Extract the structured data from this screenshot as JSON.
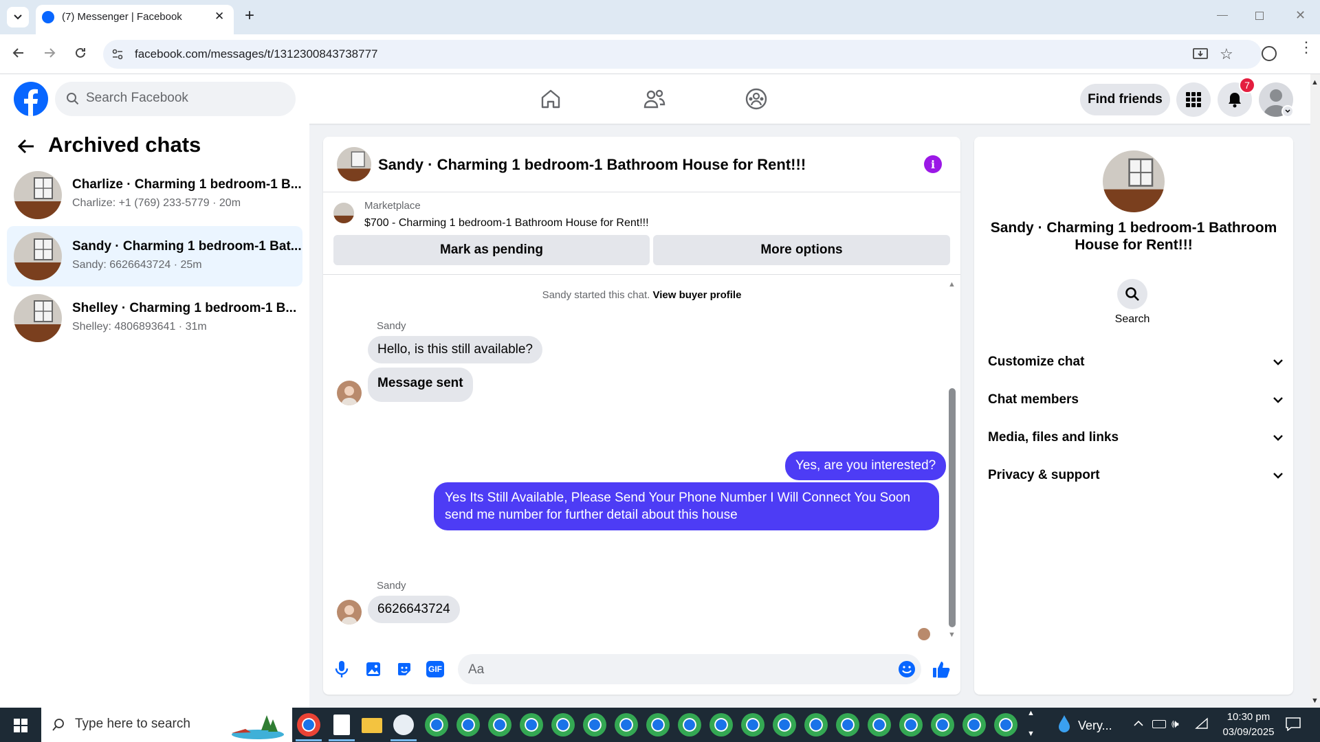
{
  "browser": {
    "tab_title": "(7) Messenger | Facebook",
    "url": "facebook.com/messages/t/1312300843738777"
  },
  "fb_header": {
    "search_placeholder": "Search Facebook",
    "find_friends": "Find friends",
    "notification_count": "7"
  },
  "left": {
    "title": "Archived chats",
    "chats": [
      {
        "name": "Charlize · Charming 1 bedroom-1 B...",
        "sub": "Charlize: +1 (769) 233-5779 · 20m"
      },
      {
        "name": "Sandy · Charming 1 bedroom-1 Bat...",
        "sub": "Sandy: 6626643724 · 25m"
      },
      {
        "name": "Shelley · Charming 1 bedroom-1 B...",
        "sub": "Shelley: 4806893641 · 31m"
      }
    ]
  },
  "conversation": {
    "title": "Sandy · Charming 1 bedroom-1 Bathroom House for Rent!!!",
    "marketplace_label": "Marketplace",
    "listing": "$700 - Charming 1 bedroom-1 Bathroom House for Rent!!!",
    "mark_pending": "Mark as pending",
    "more_options": "More options",
    "system_text": "Sandy started this chat.",
    "view_profile": "View buyer profile",
    "sender1": "Sandy",
    "msg1": "Hello, is this still available?",
    "msg2": "Message sent",
    "out1": "Yes, are you interested?",
    "out2_line1": "Yes Its Still Available, Please Send Your Phone Number I Will Connect You Soon",
    "out2_line2": "send me number for further detail about this house",
    "sender2": "Sandy",
    "msg3": "6626643724",
    "composer_placeholder": "Aa"
  },
  "right": {
    "title": "Sandy · Charming 1 bedroom-1 Bathroom House for Rent!!!",
    "search_label": "Search",
    "rows": [
      "Customize chat",
      "Chat members",
      "Media, files and links",
      "Privacy & support"
    ]
  },
  "taskbar": {
    "search_placeholder": "Type here to search",
    "weather": "Very...",
    "time": "10:30 pm",
    "date": "03/09/2025"
  },
  "colors": {
    "fb_blue": "#0866ff",
    "outgoing_bubble": "#4d3cf5",
    "selected_chat": "#ebf5ff",
    "info_purple": "#9b18e6"
  }
}
